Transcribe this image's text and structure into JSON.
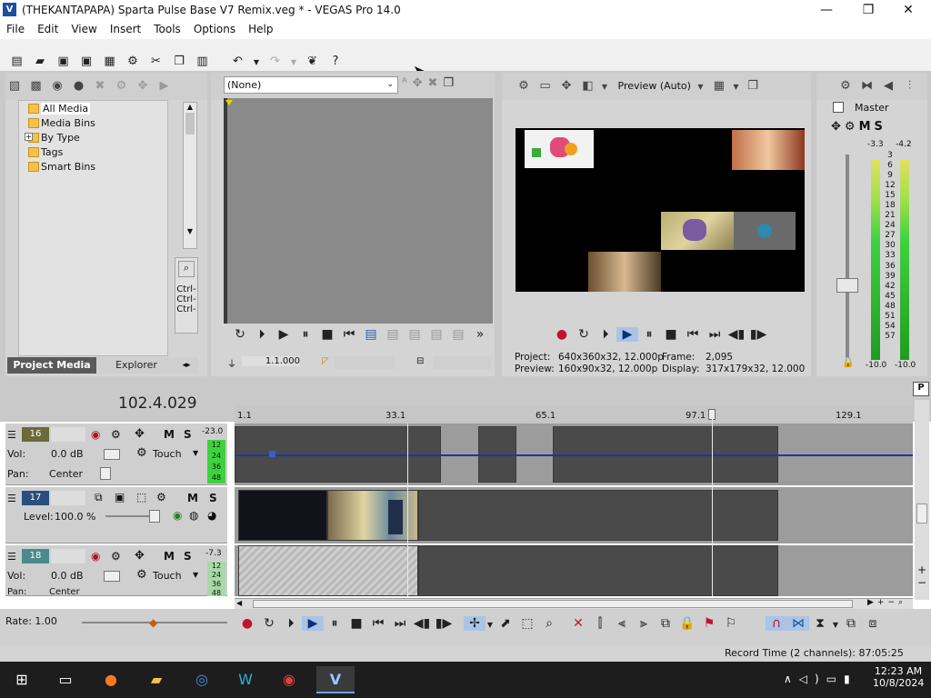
{
  "window": {
    "title": "(THEKANTAPAPA) Sparta Pulse Base V7 Remix.veg * - VEGAS Pro 14.0",
    "minimize": "—",
    "maximize": "❐",
    "close": "✕"
  },
  "menu": [
    "File",
    "Edit",
    "View",
    "Insert",
    "Tools",
    "Options",
    "Help"
  ],
  "project_media": {
    "tree": [
      "All Media",
      "Media Bins",
      "By Type",
      "Tags",
      "Smart Bins"
    ],
    "tabs": [
      "Project Media",
      "Explorer"
    ],
    "side_labels": [
      "Ctrl-",
      "Ctrl-",
      "Ctrl-"
    ]
  },
  "trimmer": {
    "dropdown_value": "(None)",
    "position": "1.1.000"
  },
  "preview": {
    "quality": "Preview (Auto)",
    "project_label": "Project:",
    "project_value": "640x360x32, 12.000p",
    "frame_label": "Frame:",
    "frame_value": "2,095",
    "preview_label": "Preview:",
    "preview_value": "160x90x32, 12.000p",
    "display_label": "Display:",
    "display_value": "317x179x32, 12.000"
  },
  "master": {
    "label": "Master",
    "peak_left": "-3.3",
    "peak_right": "-4.2",
    "scale": [
      "3",
      "6",
      "9",
      "12",
      "15",
      "18",
      "21",
      "24",
      "27",
      "30",
      "33",
      "36",
      "39",
      "42",
      "45",
      "48",
      "51",
      "54",
      "57"
    ],
    "bottom_left": "-10.0",
    "bottom_right": "-10.0"
  },
  "timeline": {
    "timecode": "102.4.029",
    "ruler": [
      "1.1",
      "33.1",
      "65.1",
      "97.1",
      "129.1"
    ],
    "tracks": [
      {
        "number": "16",
        "vol_label": "Vol:",
        "vol_value": "0.0 dB",
        "pan_label": "Pan:",
        "pan_value": "Center",
        "touch": "Touch",
        "db": "-23.0",
        "meter": [
          "12",
          "24",
          "36",
          "48"
        ]
      },
      {
        "number": "17",
        "level_label": "Level:",
        "level_value": "100.0 %"
      },
      {
        "number": "18",
        "vol_label": "Vol:",
        "vol_value": "0.0 dB",
        "pan_label": "Pan:",
        "pan_value": "Center",
        "touch": "Touch",
        "db": "-7.3",
        "meter": [
          "12",
          "24",
          "36",
          "48"
        ]
      }
    ],
    "rate": "Rate: 1.00"
  },
  "status": {
    "record_time": "Record Time (2 channels): 87:05:25"
  },
  "taskbar": {
    "time": "12:23 AM",
    "date": "10/8/2024"
  },
  "colors": {
    "accent": "#1c4fa0",
    "meter_green": "#3fd23f",
    "selected_track": "#2a4f7f"
  }
}
